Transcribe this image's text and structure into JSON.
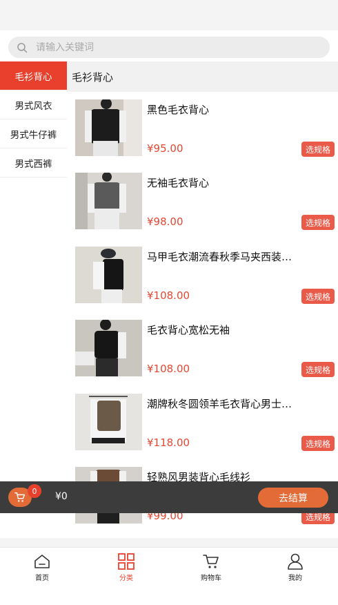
{
  "search": {
    "placeholder": "请输入关键词"
  },
  "sidebar": {
    "items": [
      {
        "label": "毛衫背心",
        "active": true
      },
      {
        "label": "男式风衣",
        "active": false
      },
      {
        "label": "男式牛仔裤",
        "active": false
      },
      {
        "label": "男式西裤",
        "active": false
      }
    ]
  },
  "content": {
    "header": "毛衫背心",
    "spec_label": "选规格",
    "products": [
      {
        "title": "黑色毛衣背心",
        "price": "¥95.00"
      },
      {
        "title": "无袖毛衣背心",
        "price": "¥98.00"
      },
      {
        "title": "马甲毛衣潮流春秋季马夹西装…",
        "price": "¥108.00"
      },
      {
        "title": "毛衣背心宽松无袖",
        "price": "¥108.00"
      },
      {
        "title": "潮牌秋冬圆领羊毛衣背心男士…",
        "price": "¥118.00"
      },
      {
        "title": "轻熟风男装背心毛线衫",
        "price": "¥99.00"
      }
    ]
  },
  "cart": {
    "badge": "0",
    "total": "¥0",
    "checkout_label": "去结算"
  },
  "tabbar": {
    "items": [
      {
        "label": "首页",
        "icon": "home-icon"
      },
      {
        "label": "分类",
        "icon": "category-icon",
        "active": true
      },
      {
        "label": "购物车",
        "icon": "cart-icon"
      },
      {
        "label": "我的",
        "icon": "user-icon"
      }
    ]
  },
  "colors": {
    "accent": "#e8402d",
    "price": "#e64732",
    "checkout": "#e26b38",
    "cartbar": "#3c3c3c"
  }
}
